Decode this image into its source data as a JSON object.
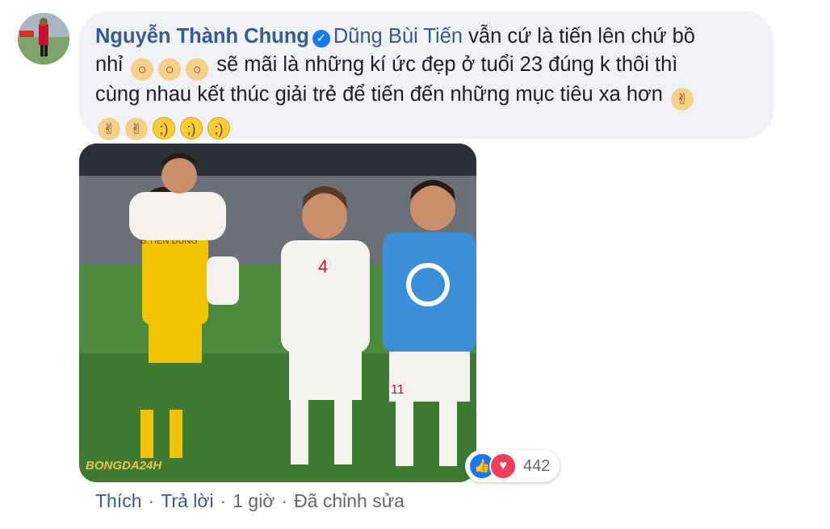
{
  "comment": {
    "author": "Nguyễn Thành Chung",
    "mention": "Dũng Bùi Tiến",
    "text_line1": "vẫn cứ là tiến lên chứ bồ",
    "text_line2a": "nhỉ",
    "text_line2b": "sẽ mãi là những kí ức đẹp ở tuổi 23 đúng k thôi thì",
    "text_line3": "cùng nhau kết thúc giải trẻ để tiến đến những mục tiêu xa hơn"
  },
  "photo": {
    "shirt_name": "B.TIẾN DŨNG",
    "shirt_number_center": "4",
    "shirt_number_right": "11",
    "watermark": "BONGDA24H"
  },
  "reactions": {
    "count": "442",
    "like_color": "#1877f2",
    "love_color": "#f33e58"
  },
  "actions": {
    "like": "Thích",
    "reply": "Trả lời",
    "time": "1 giờ",
    "edited": "Đã chỉnh sửa"
  }
}
